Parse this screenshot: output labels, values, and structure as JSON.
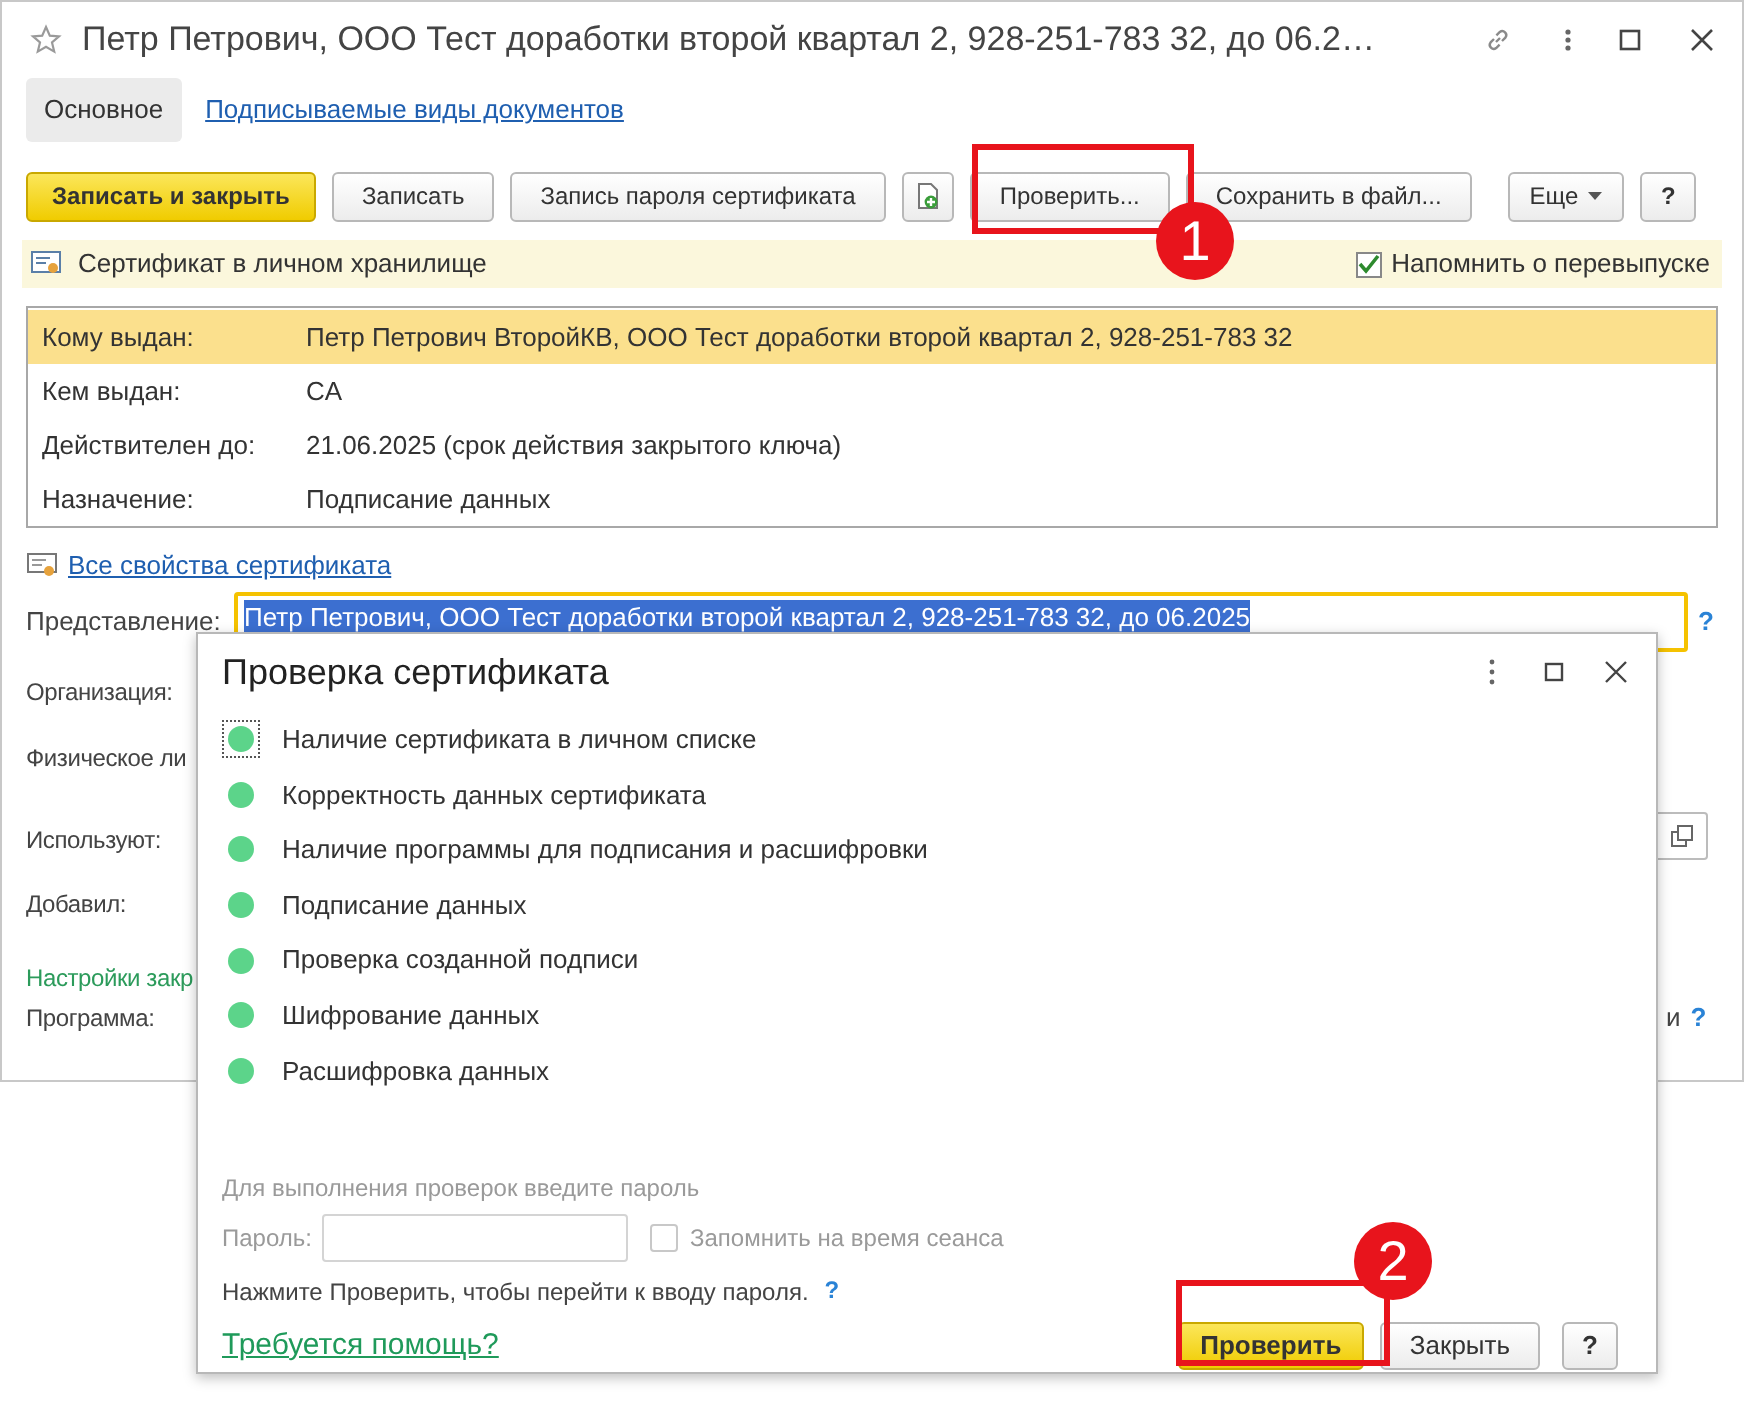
{
  "window": {
    "title": "Петр Петрович, ООО Тест доработки второй квартал 2, 928-251-783 32, до 06.2…"
  },
  "tabs": [
    {
      "label": "Основное",
      "selected": true
    },
    {
      "label": "Подписываемые виды документов",
      "selected": false
    }
  ],
  "toolbar": [
    {
      "label": "Записать и закрыть",
      "kind": "primary"
    },
    {
      "label": "Записать",
      "kind": "button"
    },
    {
      "label": "Запись пароля сертификата",
      "kind": "button"
    },
    {
      "kind": "icon"
    },
    {
      "label": "Проверить...",
      "kind": "button"
    },
    {
      "label": "Сохранить в файл...",
      "kind": "button"
    },
    {
      "label": "Еще",
      "kind": "menu"
    },
    {
      "label": "?",
      "kind": "button"
    }
  ],
  "storage_notice": {
    "text": "Сертификат в личном хранилище",
    "remind": {
      "label": "Напомнить о перевыпуске",
      "checked": true
    }
  },
  "certificate": [
    {
      "label": "Кому выдан:",
      "value": "Петр Петрович ВторойКВ, ООО Тест доработки второй квартал 2, 928-251-783 32",
      "selected": true
    },
    {
      "label": "Кем выдан:",
      "value": "CA",
      "selected": false
    },
    {
      "label": "Действителен до:",
      "value": "21.06.2025 (срок действия закрытого ключа)",
      "selected": false
    },
    {
      "label": "Назначение:",
      "value": "Подписание данных",
      "selected": false
    }
  ],
  "all_properties_link": "Все свойства сертификата",
  "presentation": {
    "label": "Представление:",
    "value": "Петр Петрович, ООО Тест доработки второй квартал 2, 928-251-783 32, до 06.2025",
    "help": "?"
  },
  "background_fields": [
    {
      "label": "Организация:",
      "kind": "label"
    },
    {
      "label": "Физическое ли",
      "kind": "label"
    },
    {
      "label": "Используют:",
      "kind": "choice"
    },
    {
      "label": "Добавил:",
      "kind": "label"
    },
    {
      "label": "Настройки закр",
      "kind": "section"
    },
    {
      "label": "Программа:",
      "kind": "help",
      "tail": "и",
      "help": "?"
    }
  ],
  "dialog": {
    "title": "Проверка сертификата",
    "checks": [
      {
        "label": "Наличие сертификата в личном списке",
        "focused": true
      },
      {
        "label": "Корректность данных сертификата",
        "focused": false
      },
      {
        "label": "Наличие программы для подписания и расшифровки",
        "focused": false
      },
      {
        "label": "Подписание данных",
        "focused": false
      },
      {
        "label": "Проверка созданной подписи",
        "focused": false
      },
      {
        "label": "Шифрование данных",
        "focused": false
      },
      {
        "label": "Расшифровка данных",
        "focused": false
      }
    ],
    "password": {
      "prompt": "Для выполнения проверок введите пароль",
      "label": "Пароль:",
      "disabled": true,
      "remember": {
        "label": "Запомнить на время сеанса",
        "checked": false
      }
    },
    "hint": "Нажмите Проверить, чтобы перейти к вводу пароля.",
    "hint_help": "?",
    "help_link": "Требуется помощь?",
    "buttons": [
      {
        "label": "Проверить",
        "kind": "primary"
      },
      {
        "label": "Закрыть",
        "kind": "button"
      },
      {
        "label": "?",
        "kind": "button"
      }
    ]
  },
  "callouts": [
    {
      "label": "1"
    },
    {
      "label": "2"
    }
  ]
}
